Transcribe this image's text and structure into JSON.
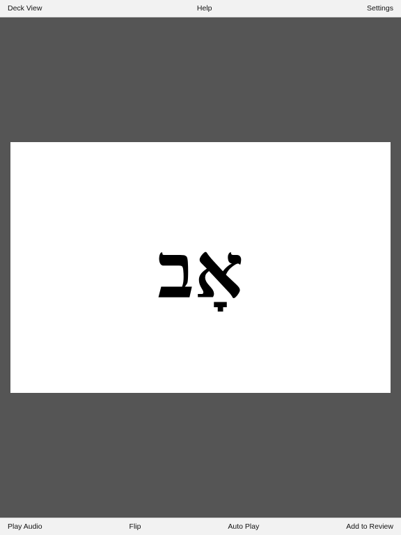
{
  "top_bar": {
    "deck_view_label": "Deck View",
    "help_label": "Help",
    "settings_label": "Settings"
  },
  "card": {
    "text": "אָב"
  },
  "bottom_bar": {
    "play_audio_label": "Play Audio",
    "flip_label": "Flip",
    "auto_play_label": "Auto Play",
    "add_to_review_label": "Add to Review"
  },
  "colors": {
    "background": "#555555",
    "bar_background": "#f2f2f2",
    "card_background": "#ffffff",
    "text": "#111111"
  }
}
